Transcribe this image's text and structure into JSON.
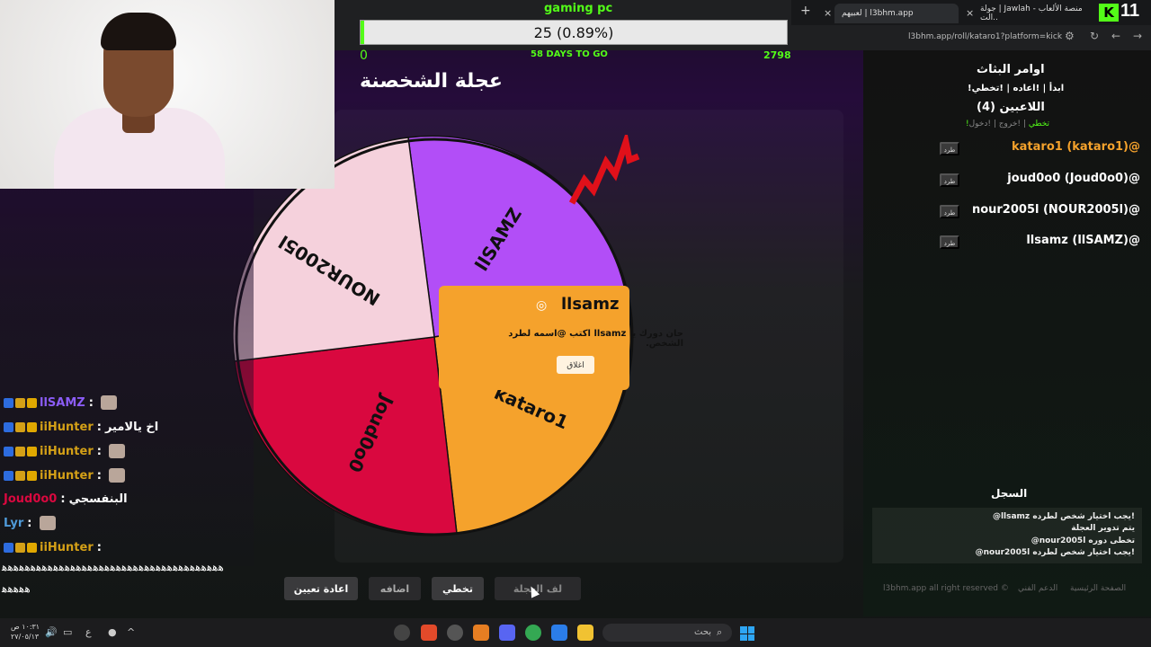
{
  "browser": {
    "tabs": [
      {
        "label": "لعبيهم | l3bhm.app",
        "active": true
      },
      {
        "label": "جولة | Jawlah - منصة الألعاب الت..",
        "active": false
      }
    ],
    "address": "l3bhm.app/roll/kataro1?platform=kick",
    "corner_number": "11",
    "new_tab_glyph": "+",
    "close_glyph": "×"
  },
  "goal": {
    "title": "gaming pc",
    "progress_text": "25 (0.89%)",
    "progress_fraction": 0.0089,
    "min": "0",
    "days_to_go": "58 DAYS TO GO",
    "max": "2798"
  },
  "page": {
    "title": "عجلة الشخصنة"
  },
  "wheel": {
    "segments": [
      {
        "label": "llSAMZ",
        "color": "#b24ef7"
      },
      {
        "label": "kataro1",
        "color": "#f5a22c"
      },
      {
        "label": "Joud0o0",
        "color": "#d9083f"
      },
      {
        "label": "NOUR2005l",
        "color": "#f5d1dc"
      }
    ]
  },
  "popup": {
    "winner": "llsamz",
    "message": "حان دورك يا llsamz اكتب @اسمه لطرد الشخص.",
    "close_label": "اغلاق"
  },
  "actions": {
    "reset": "اعادة تعيين",
    "add": "اضافه",
    "skip": "تخطي",
    "spin": "لف العجلة"
  },
  "sidebar": {
    "commands_title": "اوامر البثاث",
    "commands": "!ابدأ | !اعاده | !تخطي",
    "players_title": "اللاعبين (4)",
    "links": {
      "join": "!دخول",
      "leave": "!خروج",
      "skip": "!تخطي"
    },
    "kick_label": "طرد",
    "players": [
      "kataro1 (kataro1)@",
      "joud0o0 (Joud0o0)@",
      "nour2005l (NOUR2005l)@",
      "llsamz (llSAMZ)@"
    ],
    "log_title": "السجل",
    "log": [
      "@llsamz يجب اختيار شخص لطرده!",
      "يتم تدوير العجلة",
      "@nour2005l تخطى دوره",
      "@nour2005l يجب اختيار شخص لطرده!"
    ],
    "footer": {
      "rights": "l3bhm.app all right reserved ©",
      "support": "الدعم الفني",
      "home": "الصفحة الرئيسية"
    }
  },
  "chat": [
    {
      "user": "llSAMZ",
      "color": "#8b5cf6",
      "message": "",
      "emote": true
    },
    {
      "user": "iiHunter",
      "color": "#d4a017",
      "message": "اخ يالامير",
      "emote": false
    },
    {
      "user": "iiHunter",
      "color": "#d4a017",
      "message": "",
      "emote": true
    },
    {
      "user": "iiHunter",
      "color": "#d4a017",
      "message": "",
      "emote": true
    },
    {
      "user": "Joud0o0",
      "color": "#d9083f",
      "message": "البنفسجي",
      "emote": false
    },
    {
      "user": "Lyr",
      "color": "#4f9bd9",
      "message": "",
      "emote": true
    },
    {
      "user": "iiHunter",
      "color": "#d4a017",
      "message": "",
      "emote": false
    }
  ],
  "chat_spam": [
    "ﻫﻫﻫﻫﻫﻫﻫﻫﻫﻫﻫﻫﻫﻫﻫﻫﻫﻫﻫﻫﻫﻫﻫﻫﻫﻫﻫﻫﻫﻫﻫﻫﻫﻫﻫﻫﻫﻫﻫ",
    "ﻫﻫﻫﻫﻫ"
  ],
  "taskbar": {
    "search": "بحث",
    "time": "١٠:٣١ ص",
    "date": "٢٧/٠٥/١٣",
    "lang": "ع"
  }
}
